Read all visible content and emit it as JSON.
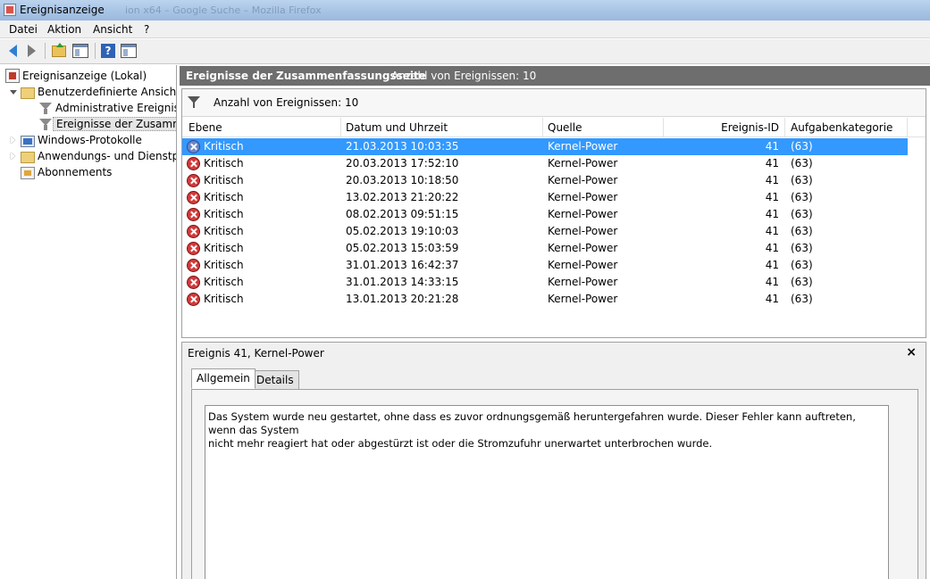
{
  "window": {
    "title": "Ereignisanzeige",
    "ghost_title": "ion x64 – Google Suche – Mozilla Firefox"
  },
  "menu": [
    "Datei",
    "Aktion",
    "Ansicht",
    "?"
  ],
  "toolbar": {
    "icons": [
      "back-arrow-icon",
      "forward-arrow-icon",
      "folder-up-icon",
      "show-hide-console-tree-icon",
      "help-icon",
      "show-hide-action-pane-icon"
    ]
  },
  "tree": {
    "root": "Ereignisanzeige (Lokal)",
    "custom_views": "Benutzerdefinierte Ansichten",
    "admin_events": "Administrative Ereignisse",
    "summary_events": "Ereignisse der Zusammenfassungsseite",
    "windows_logs": "Windows-Protokolle",
    "app_service_logs": "Anwendungs- und Dienstprotokolle",
    "subscriptions": "Abonnements"
  },
  "pane": {
    "title": "Ereignisse der Zusammenfassungsseite",
    "count": "Anzahl von Ereignissen: 10"
  },
  "filter": {
    "text": "Anzahl von Ereignissen: 10"
  },
  "columns": {
    "level": "Ebene",
    "datetime": "Datum und Uhrzeit",
    "source": "Quelle",
    "event_id": "Ereignis-ID",
    "task_category": "Aufgabenkategorie"
  },
  "events": [
    {
      "level": "Kritisch",
      "datetime": "21.03.2013 10:03:35",
      "source": "Kernel-Power",
      "event_id": "41",
      "task_category": "(63)"
    },
    {
      "level": "Kritisch",
      "datetime": "20.03.2013 17:52:10",
      "source": "Kernel-Power",
      "event_id": "41",
      "task_category": "(63)"
    },
    {
      "level": "Kritisch",
      "datetime": "20.03.2013 10:18:50",
      "source": "Kernel-Power",
      "event_id": "41",
      "task_category": "(63)"
    },
    {
      "level": "Kritisch",
      "datetime": "13.02.2013 21:20:22",
      "source": "Kernel-Power",
      "event_id": "41",
      "task_category": "(63)"
    },
    {
      "level": "Kritisch",
      "datetime": "08.02.2013 09:51:15",
      "source": "Kernel-Power",
      "event_id": "41",
      "task_category": "(63)"
    },
    {
      "level": "Kritisch",
      "datetime": "05.02.2013 19:10:03",
      "source": "Kernel-Power",
      "event_id": "41",
      "task_category": "(63)"
    },
    {
      "level": "Kritisch",
      "datetime": "05.02.2013 15:03:59",
      "source": "Kernel-Power",
      "event_id": "41",
      "task_category": "(63)"
    },
    {
      "level": "Kritisch",
      "datetime": "31.01.2013 16:42:37",
      "source": "Kernel-Power",
      "event_id": "41",
      "task_category": "(63)"
    },
    {
      "level": "Kritisch",
      "datetime": "31.01.2013 14:33:15",
      "source": "Kernel-Power",
      "event_id": "41",
      "task_category": "(63)"
    },
    {
      "level": "Kritisch",
      "datetime": "13.01.2013 20:21:28",
      "source": "Kernel-Power",
      "event_id": "41",
      "task_category": "(63)"
    }
  ],
  "detail": {
    "title": "Ereignis 41, Kernel-Power",
    "close": "×",
    "tabs": [
      "Allgemein",
      "Details"
    ],
    "description": "Das System wurde neu gestartet, ohne dass es zuvor ordnungsgemäß heruntergefahren wurde. Dieser Fehler kann auftreten, wenn das System\nnicht mehr reagiert hat oder abgestürzt ist oder die Stromzufuhr unerwartet unterbrochen wurde."
  },
  "colors": {
    "selection": "#3399ff",
    "header_bar": "#6e6e6e",
    "critical": "#d23a3a"
  }
}
